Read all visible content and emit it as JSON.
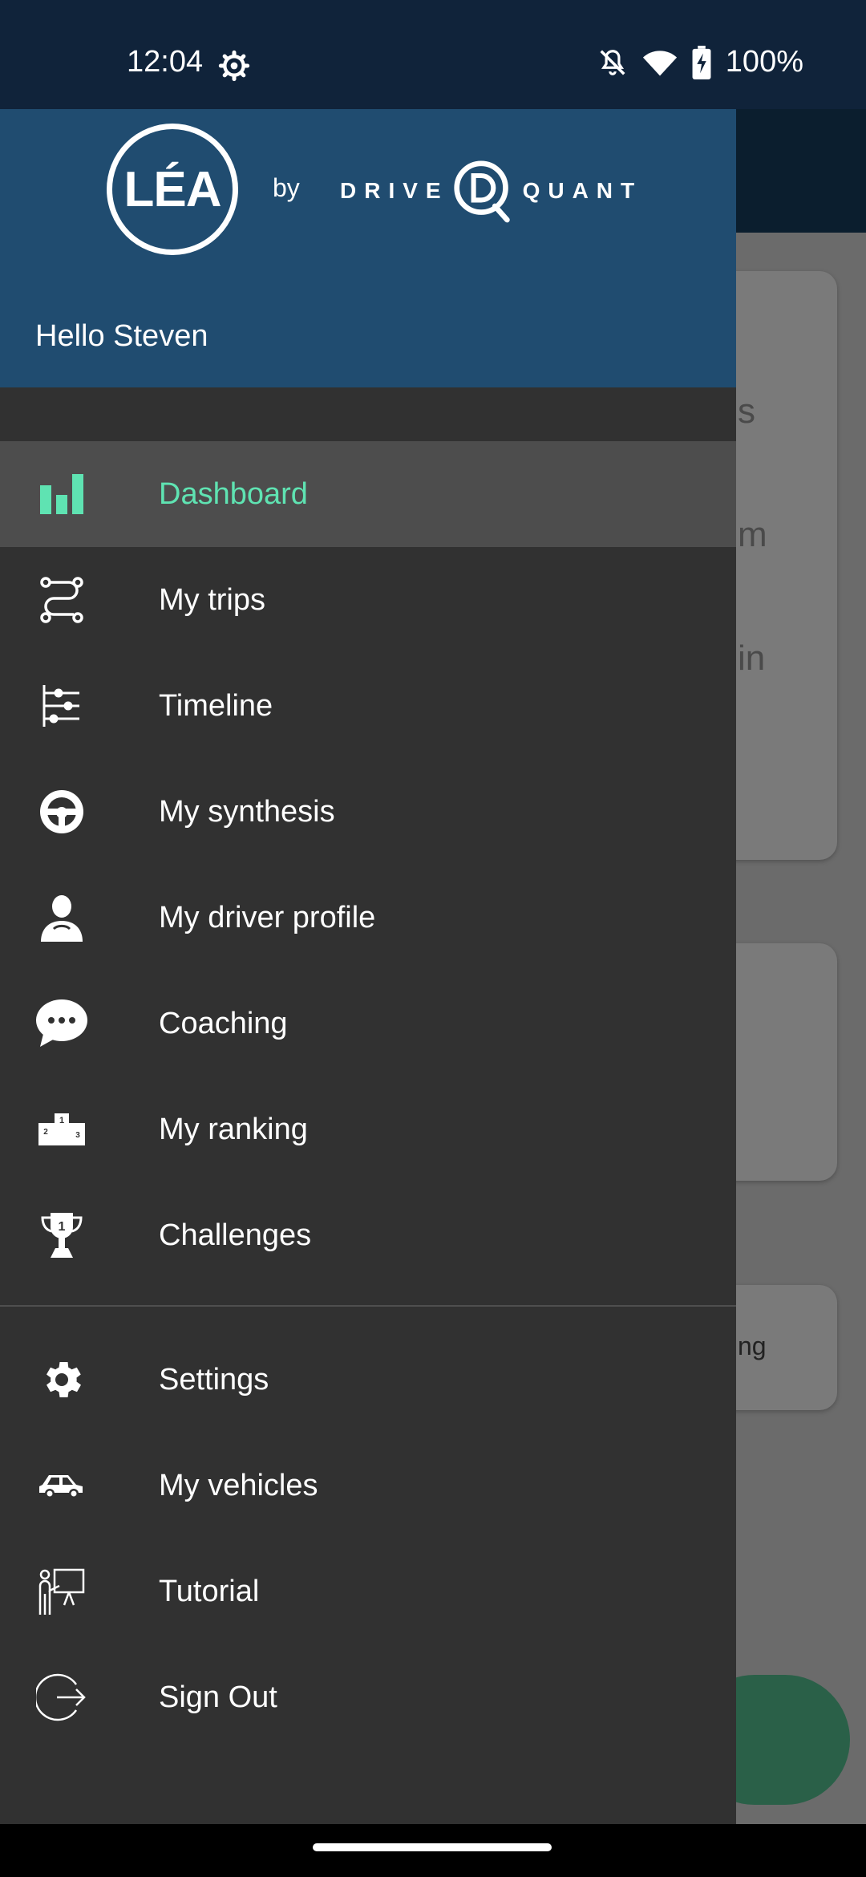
{
  "status_bar": {
    "time": "12:04",
    "battery_text": "100%",
    "icons": [
      "settings-gear-icon",
      "notifications-off-icon",
      "wifi-icon",
      "battery-charging-icon"
    ]
  },
  "background": {
    "text_fragments": [
      "s",
      "m",
      "in",
      "ng"
    ]
  },
  "drawer": {
    "logo": {
      "lea": "LÉA",
      "by": "by",
      "brand_left": "DRIVE",
      "brand_right": "QUANT"
    },
    "greeting": "Hello Steven",
    "items": [
      {
        "label": "Dashboard",
        "icon": "bar-chart-icon",
        "active": true
      },
      {
        "label": "My trips",
        "icon": "route-icon",
        "active": false
      },
      {
        "label": "Timeline",
        "icon": "timeline-icon",
        "active": false
      },
      {
        "label": "My synthesis",
        "icon": "steering-wheel-icon",
        "active": false
      },
      {
        "label": "My driver profile",
        "icon": "driver-icon",
        "active": false
      },
      {
        "label": "Coaching",
        "icon": "chat-bubble-icon",
        "active": false
      },
      {
        "label": "My ranking",
        "icon": "podium-icon",
        "active": false
      },
      {
        "label": "Challenges",
        "icon": "trophy-icon",
        "active": false
      },
      {
        "label": "Settings",
        "icon": "gear-icon",
        "active": false
      },
      {
        "label": "My vehicles",
        "icon": "car-icon",
        "active": false
      },
      {
        "label": "Tutorial",
        "icon": "presentation-icon",
        "active": false
      },
      {
        "label": "Sign Out",
        "icon": "sign-out-icon",
        "active": false
      }
    ]
  },
  "colors": {
    "accent": "#5fe3b2",
    "drawer_bg": "#313131",
    "header_bg": "#204c70",
    "active_bg": "#4d4d4d"
  }
}
